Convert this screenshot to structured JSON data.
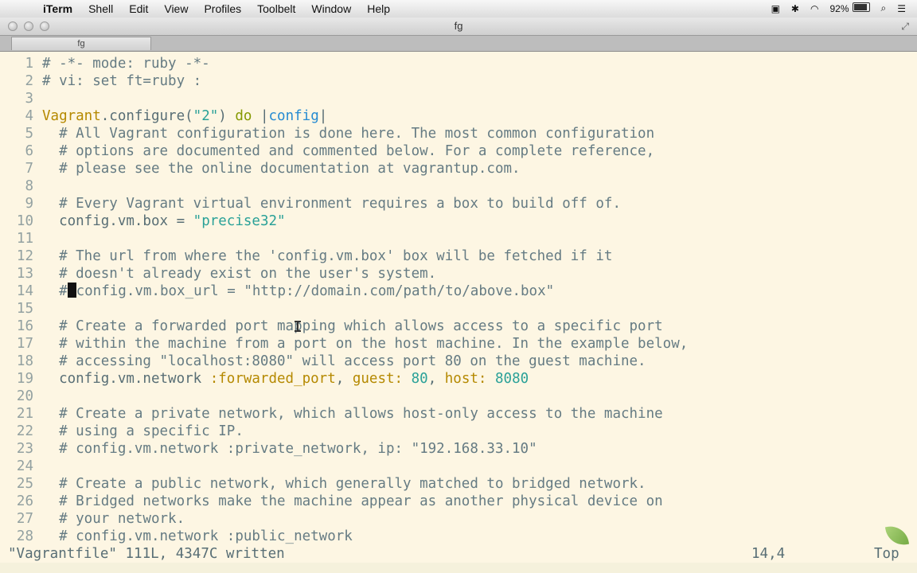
{
  "menubar": {
    "app": "iTerm",
    "items": [
      "Shell",
      "Edit",
      "View",
      "Profiles",
      "Toolbelt",
      "Window",
      "Help"
    ],
    "battery": "92%"
  },
  "window": {
    "title": "fg",
    "tab_label": "fg"
  },
  "lines": [
    {
      "n": "1",
      "segs": [
        {
          "t": "# -*- mode: ruby -*-",
          "c": "comment"
        }
      ]
    },
    {
      "n": "2",
      "segs": [
        {
          "t": "# vi: set ft=ruby :",
          "c": "comment"
        }
      ]
    },
    {
      "n": "3",
      "segs": []
    },
    {
      "n": "4",
      "segs": [
        {
          "t": "Vagrant",
          "c": "const"
        },
        {
          "t": ".configure(",
          "c": "plain"
        },
        {
          "t": "\"2\"",
          "c": "str"
        },
        {
          "t": ") ",
          "c": "plain"
        },
        {
          "t": "do",
          "c": "kw"
        },
        {
          "t": " |",
          "c": "plain"
        },
        {
          "t": "config",
          "c": "var"
        },
        {
          "t": "|",
          "c": "plain"
        }
      ]
    },
    {
      "n": "5",
      "segs": [
        {
          "t": "  # All Vagrant configuration is done here. The most common configuration",
          "c": "comment"
        }
      ]
    },
    {
      "n": "6",
      "segs": [
        {
          "t": "  # options are documented and commented below. For a complete reference,",
          "c": "comment"
        }
      ]
    },
    {
      "n": "7",
      "segs": [
        {
          "t": "  # please see the online documentation at vagrantup.com.",
          "c": "comment"
        }
      ]
    },
    {
      "n": "8",
      "segs": []
    },
    {
      "n": "9",
      "segs": [
        {
          "t": "  # Every Vagrant virtual environment requires a box to build off of.",
          "c": "comment"
        }
      ]
    },
    {
      "n": "10",
      "segs": [
        {
          "t": "  config.vm.box = ",
          "c": "plain"
        },
        {
          "t": "\"precise32\"",
          "c": "str"
        }
      ]
    },
    {
      "n": "11",
      "segs": []
    },
    {
      "n": "12",
      "segs": [
        {
          "t": "  # The url from where the 'config.vm.box' box will be fetched if it",
          "c": "comment"
        }
      ]
    },
    {
      "n": "13",
      "segs": [
        {
          "t": "  # doesn't already exist on the user's system.",
          "c": "comment"
        }
      ]
    },
    {
      "n": "14",
      "segs": [
        {
          "t": "  #",
          "c": "comment"
        },
        {
          "t": "",
          "c": "cursor"
        },
        {
          "t": "config.vm.box_url = \"http://domain.com/path/to/above.box\"",
          "c": "comment"
        }
      ]
    },
    {
      "n": "15",
      "segs": []
    },
    {
      "n": "16",
      "segs": [
        {
          "t": "  # Create a forwarded port mapping which allows access to a specific port",
          "c": "comment"
        }
      ]
    },
    {
      "n": "17",
      "segs": [
        {
          "t": "  # within the machine from a port on the host machine. In the example below,",
          "c": "comment"
        }
      ]
    },
    {
      "n": "18",
      "segs": [
        {
          "t": "  # accessing \"localhost:8080\" will access port 80 on the guest machine.",
          "c": "comment"
        }
      ]
    },
    {
      "n": "19",
      "segs": [
        {
          "t": "  config.vm.network ",
          "c": "plain"
        },
        {
          "t": ":forwarded_port",
          "c": "const"
        },
        {
          "t": ", ",
          "c": "plain"
        },
        {
          "t": "guest:",
          "c": "const"
        },
        {
          "t": " ",
          "c": "plain"
        },
        {
          "t": "80",
          "c": "str"
        },
        {
          "t": ", ",
          "c": "plain"
        },
        {
          "t": "host:",
          "c": "const"
        },
        {
          "t": " ",
          "c": "plain"
        },
        {
          "t": "8080",
          "c": "str"
        }
      ]
    },
    {
      "n": "20",
      "segs": []
    },
    {
      "n": "21",
      "segs": [
        {
          "t": "  # Create a private network, which allows host-only access to the machine",
          "c": "comment"
        }
      ]
    },
    {
      "n": "22",
      "segs": [
        {
          "t": "  # using a specific IP.",
          "c": "comment"
        }
      ]
    },
    {
      "n": "23",
      "segs": [
        {
          "t": "  # config.vm.network :private_network, ip: \"192.168.33.10\"",
          "c": "comment"
        }
      ]
    },
    {
      "n": "24",
      "segs": []
    },
    {
      "n": "25",
      "segs": [
        {
          "t": "  # Create a public network, which generally matched to bridged network.",
          "c": "comment"
        }
      ]
    },
    {
      "n": "26",
      "segs": [
        {
          "t": "  # Bridged networks make the machine appear as another physical device on",
          "c": "comment"
        }
      ]
    },
    {
      "n": "27",
      "segs": [
        {
          "t": "  # your network.",
          "c": "comment"
        }
      ]
    },
    {
      "n": "28",
      "segs": [
        {
          "t": "  # config.vm.network :public_network",
          "c": "comment"
        }
      ]
    }
  ],
  "statusline": {
    "message": "\"Vagrantfile\" 111L, 4347C written",
    "position": "14,4",
    "scroll": "Top"
  }
}
